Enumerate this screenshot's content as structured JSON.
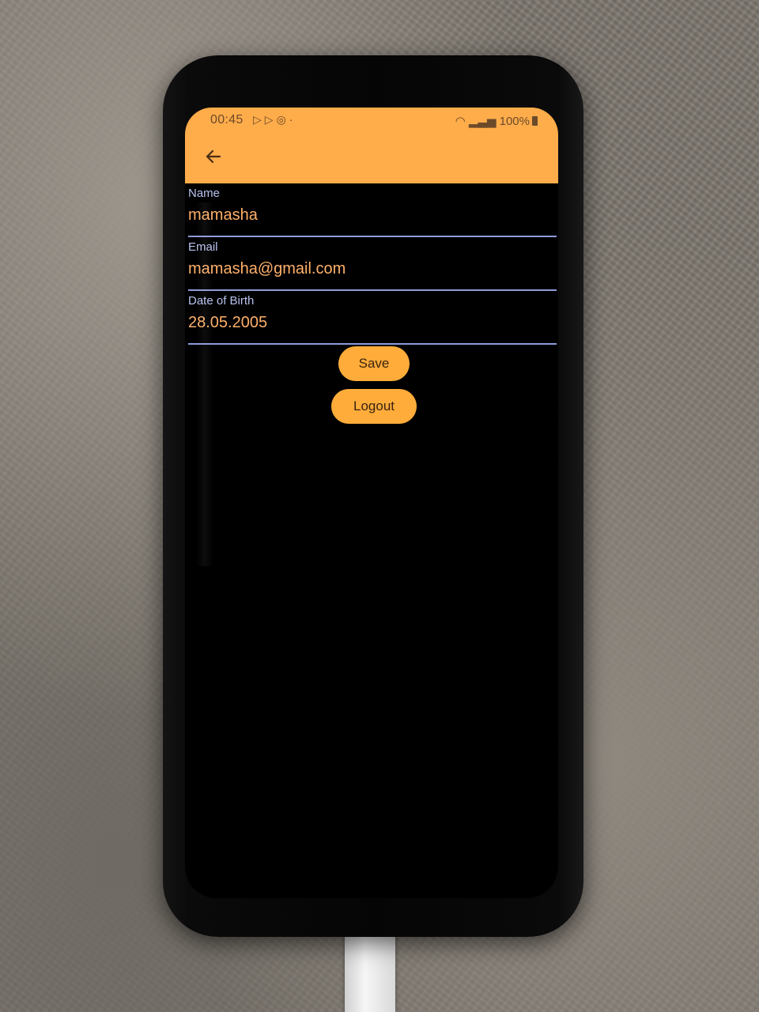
{
  "status_bar": {
    "time": "00:45",
    "battery": "100%"
  },
  "app_bar": {
    "color": "#ffac4a"
  },
  "form": {
    "name": {
      "label": "Name",
      "value": "mamasha"
    },
    "email": {
      "label": "Email",
      "value": "mamasha@gmail.com"
    },
    "dob": {
      "label": "Date of Birth",
      "value": "28.05.2005"
    }
  },
  "buttons": {
    "save": "Save",
    "logout": "Logout"
  },
  "colors": {
    "accent": "#ffac3a",
    "field_text": "#ffb06a",
    "label": "#b8c2ee",
    "underline": "#8e9cd9"
  }
}
